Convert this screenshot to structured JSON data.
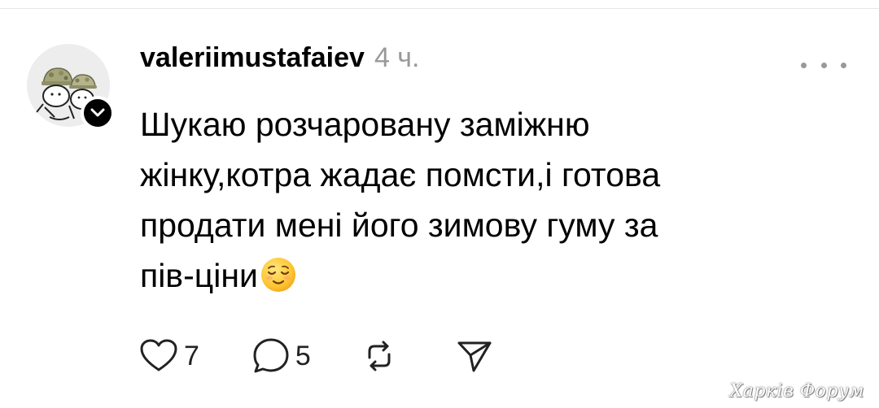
{
  "post": {
    "username": "valeriimustafaiev",
    "timestamp": "4 ч.",
    "text_lines": [
      "Шукаю розчаровану заміжню",
      "жінку,котра жадає помсти,і готова",
      "продати мені його зимову гуму за",
      "пів-ціни"
    ],
    "emoji": "relieved-face-emoji",
    "avatar": "cartoon-characters-in-military-helmets"
  },
  "actions": {
    "likes": "7",
    "replies": "5",
    "repost": "repost-icon",
    "share": "share-icon"
  },
  "watermark": "Харків Форум",
  "colors": {
    "text": "#000000",
    "muted": "#999999",
    "badge": "#000000",
    "background": "#ffffff"
  }
}
